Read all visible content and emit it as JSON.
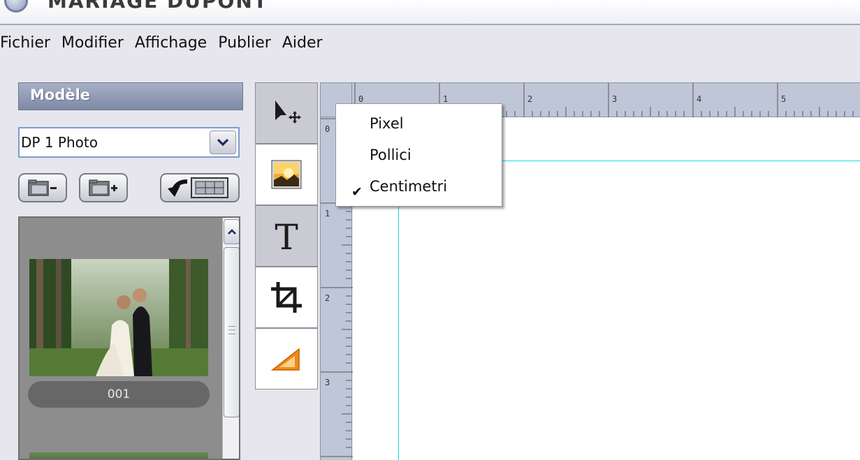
{
  "window": {
    "title": "MARIAGE DUPONT"
  },
  "menu": [
    "Fichier",
    "Modifier",
    "Affichage",
    "Publier",
    "Aider"
  ],
  "left_panel": {
    "header": "Modèle",
    "template_select": {
      "value": "DP 1 Photo"
    },
    "thumbnails": [
      {
        "caption": "001"
      }
    ]
  },
  "units_menu": {
    "options": [
      "Pixel",
      "Pollici",
      "Centimetri"
    ],
    "checked": "Centimetri"
  },
  "rulers": {
    "horizontal": [
      "0",
      "1",
      "2",
      "3",
      "4",
      "5"
    ],
    "vertical": [
      "0",
      "1",
      "2",
      "3"
    ]
  },
  "colors": {
    "guide": "#18d8e6",
    "panel_header": "#8d98b3",
    "ruler": "#bec6d8"
  },
  "icons": {
    "toolbox": [
      "move-tool-icon",
      "image-tool-icon",
      "text-tool-icon",
      "crop-tool-icon",
      "triangle-tool-icon"
    ],
    "buttons": [
      "remove-folder-icon",
      "add-folder-icon",
      "apply-template-icon"
    ]
  }
}
